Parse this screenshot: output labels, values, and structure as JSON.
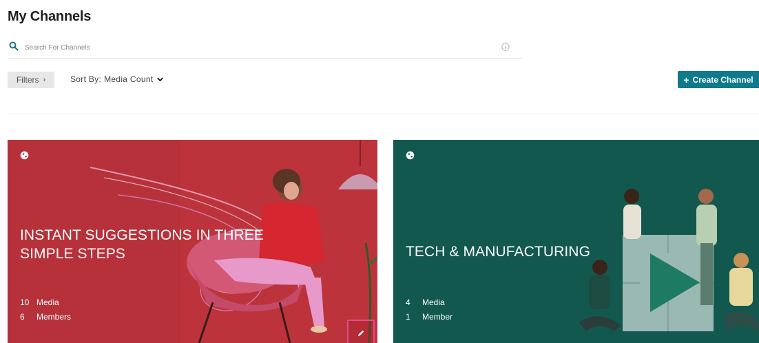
{
  "header": {
    "title": "My Channels"
  },
  "search": {
    "placeholder": "Search For Channels",
    "value": ""
  },
  "toolbar": {
    "filters_label": "Filters",
    "sort_prefix": "Sort By:",
    "sort_value": "Media Count",
    "create_label": "Create Channel"
  },
  "colors": {
    "accent": "#0f7a8c",
    "card_1_bg": "#b6313a",
    "card_2_bg": "#12584e",
    "edit_highlight": "#e8488f"
  },
  "channels": [
    {
      "title": "INSTANT SUGGESTIONS IN THREE SIMPLE STEPS",
      "visibility_icon": "globe-icon",
      "media_count": "10",
      "media_label": "Media",
      "member_count": "6",
      "member_label": "Members",
      "has_edit": true
    },
    {
      "title": "TECH & MANUFACTURING",
      "visibility_icon": "globe-icon",
      "media_count": "4",
      "media_label": "Media",
      "member_count": "1",
      "member_label": "Member",
      "has_edit": false
    }
  ]
}
